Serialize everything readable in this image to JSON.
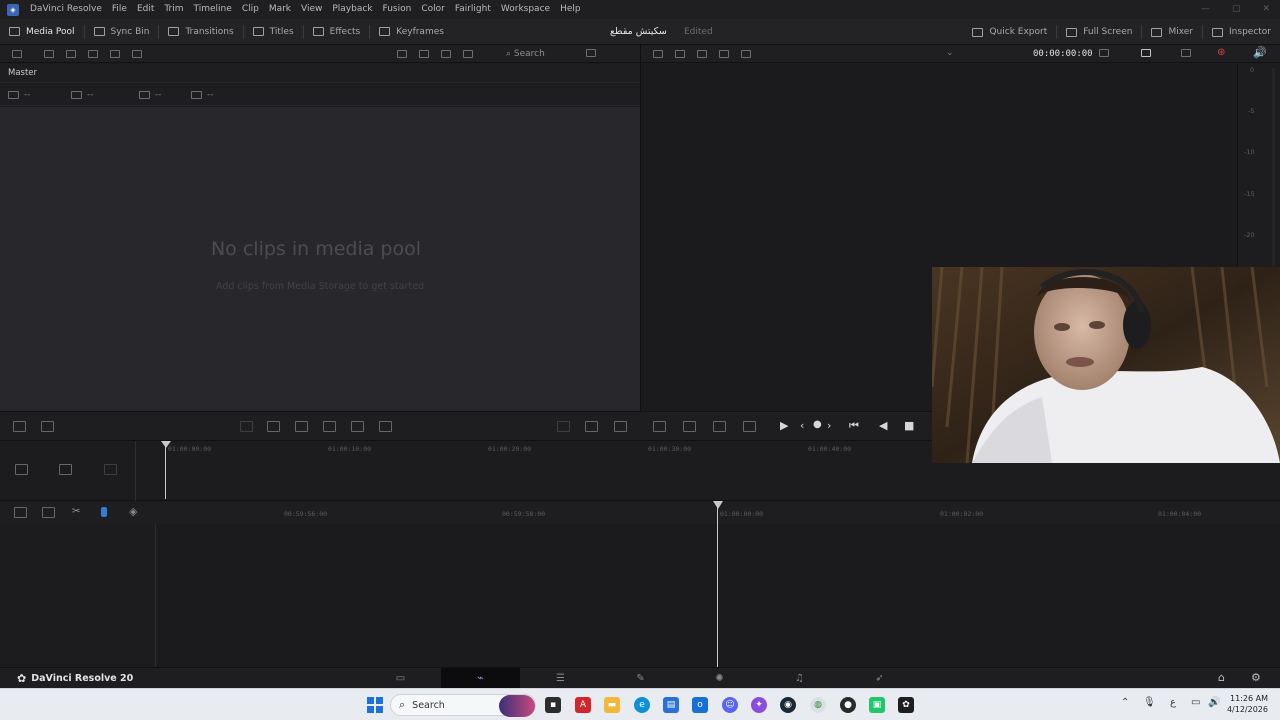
{
  "menubar": {
    "app_name": "DaVinci Resolve",
    "items": [
      "File",
      "Edit",
      "Trim",
      "Timeline",
      "Clip",
      "Mark",
      "View",
      "Playback",
      "Fusion",
      "Color",
      "Fairlight",
      "Workspace",
      "Help"
    ]
  },
  "toolbar": {
    "left": [
      {
        "label": "Media Pool",
        "icon": "media-pool-icon",
        "active": true
      },
      {
        "label": "Sync Bin",
        "icon": "sync-bin-icon",
        "active": false
      },
      {
        "label": "Transitions",
        "icon": "transitions-icon",
        "active": false
      },
      {
        "label": "Titles",
        "icon": "titles-icon",
        "active": false
      },
      {
        "label": "Effects",
        "icon": "effects-icon",
        "active": false
      },
      {
        "label": "Keyframes",
        "icon": "keyframes-icon",
        "active": false
      }
    ],
    "project_title": "سكيتش مقطع",
    "project_status": "Edited",
    "right": [
      {
        "label": "Quick Export",
        "icon": "upload-icon"
      },
      {
        "label": "Full Screen",
        "icon": "fullscreen-icon"
      },
      {
        "label": "Mixer",
        "icon": "mixer-icon"
      },
      {
        "label": "Inspector",
        "icon": "inspector-icon"
      }
    ]
  },
  "media_pool": {
    "search_placeholder": "Search",
    "bin_label": "Master",
    "columns": [
      "--",
      "--",
      "--",
      "--"
    ],
    "empty_title": "No clips in media pool",
    "empty_subtitle": "Add clips from Media Storage to get started"
  },
  "viewer": {
    "timecode": "00:00:00:00",
    "meter_labels": [
      "0",
      "-5",
      "-10",
      "-15",
      "-20"
    ]
  },
  "upper_timeline": {
    "ticks": [
      "01:00:00:00",
      "01:00:10:00",
      "01:00:20:00",
      "01:00:30:00",
      "01:00:40:00"
    ]
  },
  "lower_timeline": {
    "ticks": [
      "00:59:56:00",
      "00:59:58:00",
      "01:00:00:00",
      "01:00:02:00",
      "01:00:04:00"
    ]
  },
  "pagebar": {
    "brand": "DaVinci Resolve 20",
    "pages": [
      "Media",
      "Cut",
      "Edit",
      "Fusion",
      "Color",
      "Fairlight",
      "Deliver"
    ],
    "active_page": "Cut"
  },
  "taskbar": {
    "search_label": "Search",
    "language": "ع",
    "time": "11:26 AM",
    "date": "4/12/2026"
  }
}
